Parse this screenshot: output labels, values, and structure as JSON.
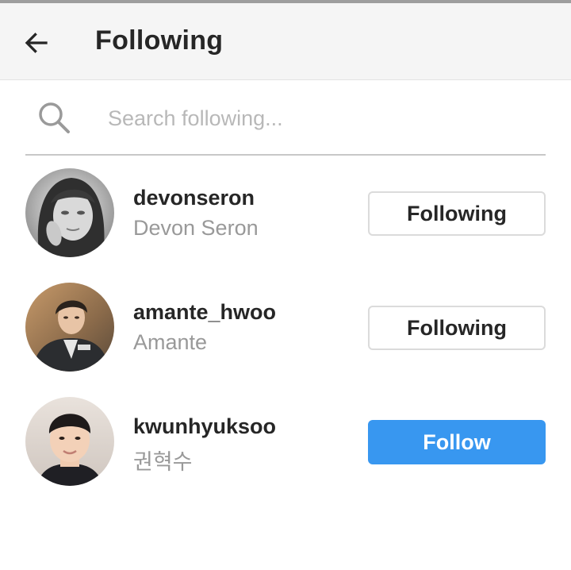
{
  "header": {
    "title": "Following",
    "back_icon": "arrow-left-icon"
  },
  "search": {
    "placeholder": "Search following...",
    "value": "",
    "icon": "search-icon"
  },
  "users": [
    {
      "username": "devonseron",
      "full_name": "Devon Seron",
      "button": "Following",
      "button_state": "following"
    },
    {
      "username": "amante_hwoo",
      "full_name": "Amante",
      "button": "Following",
      "button_state": "following"
    },
    {
      "username": "kwunhyuksoo",
      "full_name": "권혁수",
      "button": "Follow",
      "button_state": "follow"
    }
  ],
  "colors": {
    "primary": "#3897f0",
    "text": "#262626",
    "secondary_text": "#999999",
    "header_bg": "#f5f5f5",
    "button_border": "#dbdbdb"
  }
}
